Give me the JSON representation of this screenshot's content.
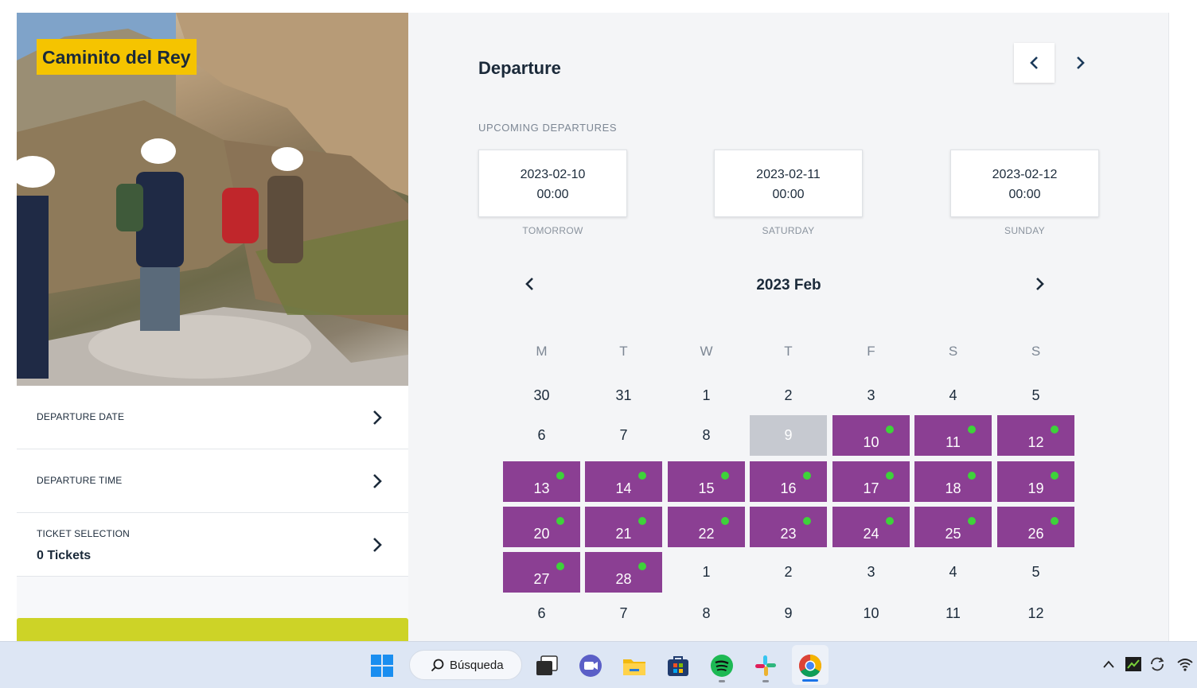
{
  "sidebar": {
    "title": "Caminito del Rey",
    "rows": [
      {
        "label": "DEPARTURE DATE",
        "value": ""
      },
      {
        "label": "DEPARTURE TIME",
        "value": ""
      },
      {
        "label": "TICKET SELECTION",
        "value": "0 Tickets"
      }
    ]
  },
  "departure": {
    "title": "Departure",
    "upcoming_label": "UPCOMING DEPARTURES",
    "cards": [
      {
        "date": "2023-02-10",
        "time": "00:00",
        "sub": "TOMORROW"
      },
      {
        "date": "2023-02-11",
        "time": "00:00",
        "sub": "SATURDAY"
      },
      {
        "date": "2023-02-12",
        "time": "00:00",
        "sub": "SUNDAY"
      }
    ]
  },
  "calendar": {
    "title": "2023 Feb",
    "weekdays": [
      "M",
      "T",
      "W",
      "T",
      "F",
      "S",
      "S"
    ],
    "weeks": [
      [
        {
          "d": "30",
          "s": "plain"
        },
        {
          "d": "31",
          "s": "plain"
        },
        {
          "d": "1",
          "s": "plain"
        },
        {
          "d": "2",
          "s": "plain"
        },
        {
          "d": "3",
          "s": "plain"
        },
        {
          "d": "4",
          "s": "plain"
        },
        {
          "d": "5",
          "s": "plain"
        }
      ],
      [
        {
          "d": "6",
          "s": "plain"
        },
        {
          "d": "7",
          "s": "plain"
        },
        {
          "d": "8",
          "s": "plain"
        },
        {
          "d": "9",
          "s": "past"
        },
        {
          "d": "10",
          "s": "avail"
        },
        {
          "d": "11",
          "s": "avail"
        },
        {
          "d": "12",
          "s": "avail"
        }
      ],
      [
        {
          "d": "13",
          "s": "avail"
        },
        {
          "d": "14",
          "s": "avail"
        },
        {
          "d": "15",
          "s": "avail"
        },
        {
          "d": "16",
          "s": "avail"
        },
        {
          "d": "17",
          "s": "avail"
        },
        {
          "d": "18",
          "s": "avail"
        },
        {
          "d": "19",
          "s": "avail"
        }
      ],
      [
        {
          "d": "20",
          "s": "avail"
        },
        {
          "d": "21",
          "s": "avail"
        },
        {
          "d": "22",
          "s": "avail"
        },
        {
          "d": "23",
          "s": "avail"
        },
        {
          "d": "24",
          "s": "avail"
        },
        {
          "d": "25",
          "s": "avail"
        },
        {
          "d": "26",
          "s": "avail"
        }
      ],
      [
        {
          "d": "27",
          "s": "avail"
        },
        {
          "d": "28",
          "s": "avail"
        },
        {
          "d": "1",
          "s": "plain"
        },
        {
          "d": "2",
          "s": "plain"
        },
        {
          "d": "3",
          "s": "plain"
        },
        {
          "d": "4",
          "s": "plain"
        },
        {
          "d": "5",
          "s": "plain"
        }
      ],
      [
        {
          "d": "6",
          "s": "plain"
        },
        {
          "d": "7",
          "s": "plain"
        },
        {
          "d": "8",
          "s": "plain"
        },
        {
          "d": "9",
          "s": "plain"
        },
        {
          "d": "10",
          "s": "plain"
        },
        {
          "d": "11",
          "s": "plain"
        },
        {
          "d": "12",
          "s": "plain"
        }
      ]
    ]
  },
  "taskbar": {
    "search_label": "Búsqueda",
    "apps": [
      "windows-start-icon",
      "task-view-icon",
      "teams-meet-icon",
      "file-explorer-icon",
      "microsoft-store-icon",
      "spotify-icon",
      "slack-icon",
      "chrome-icon"
    ]
  },
  "colors": {
    "available": "#8b3f93",
    "past": "#c6c9d0",
    "dot": "#3ed23a",
    "badge": "#f5c400",
    "cta": "#cdd327"
  }
}
